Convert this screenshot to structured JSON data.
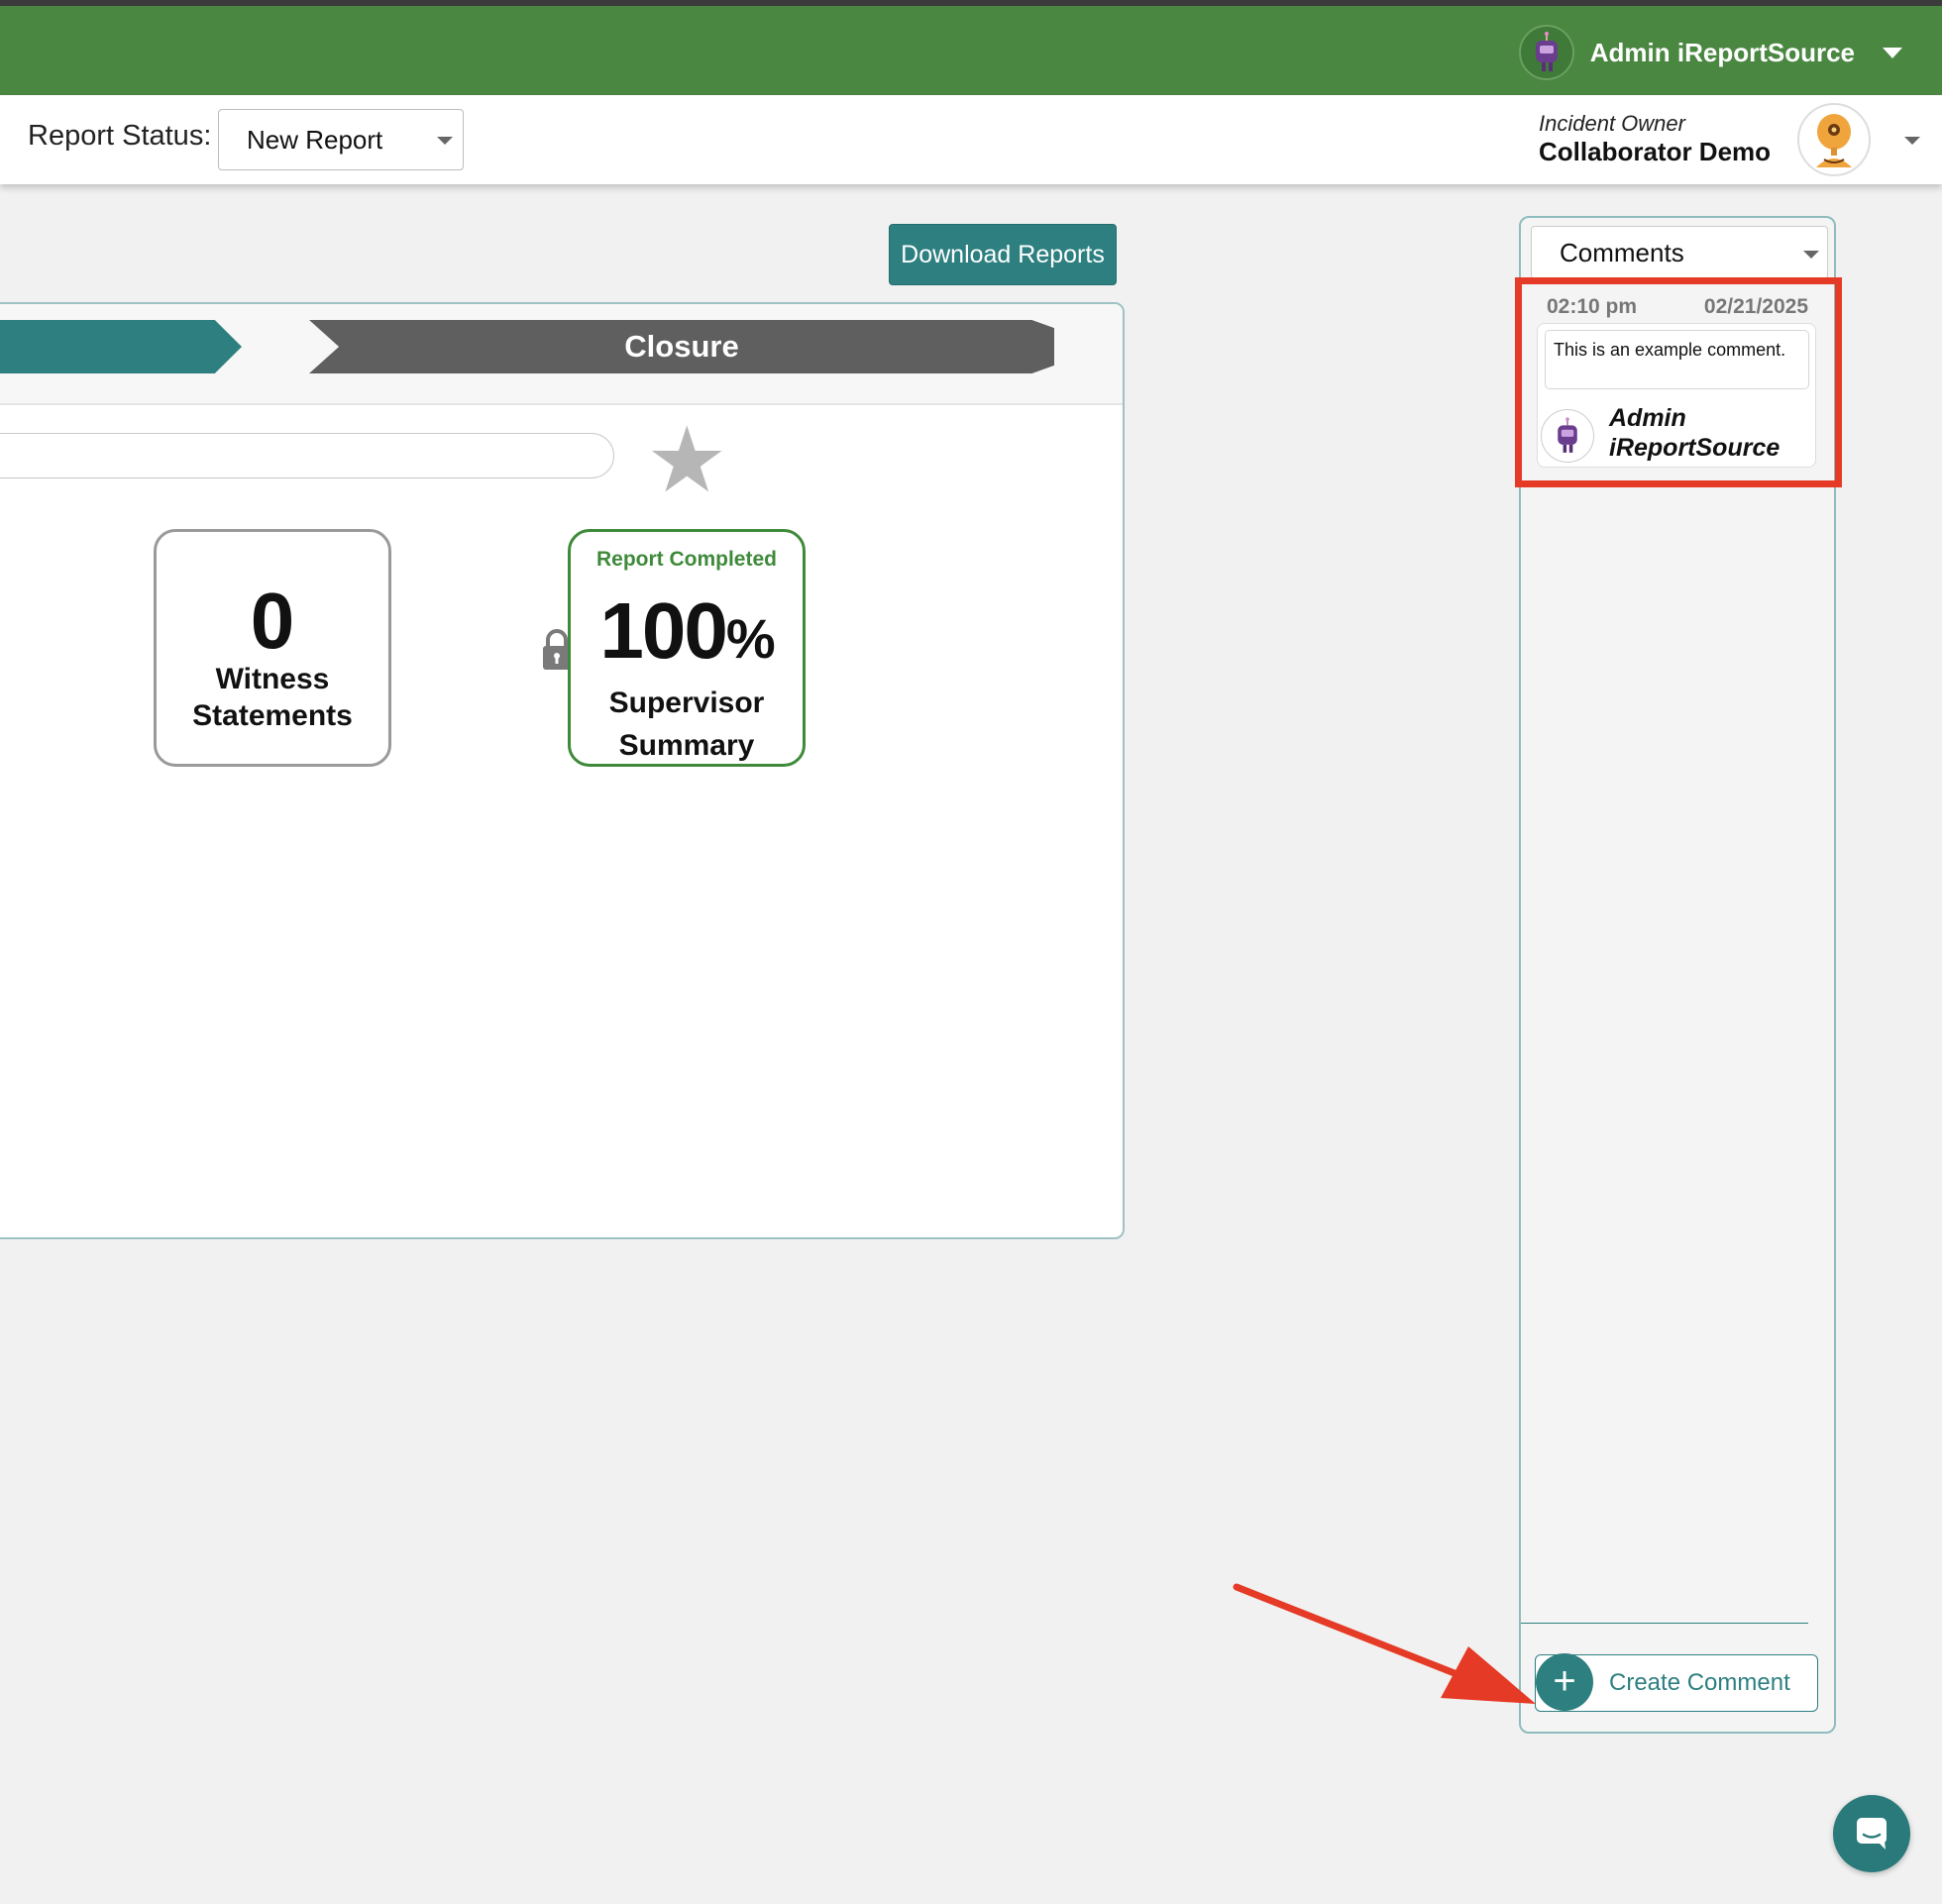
{
  "header": {
    "user_name": "Admin iReportSource",
    "user_avatar_icon": "robot-avatar-icon"
  },
  "status_bar": {
    "label": "Report Status:",
    "selected_status": "New Report",
    "owner_label": "Incident Owner",
    "owner_name": "Collaborator Demo"
  },
  "toolbar": {
    "download_label": "Download Reports"
  },
  "phases": {
    "current": "Closure"
  },
  "stats": {
    "witness": {
      "count": "0",
      "label_line1": "Witness",
      "label_line2": "Statements"
    },
    "supervisor": {
      "status": "Report Completed",
      "percent": "100",
      "percent_sign": "%",
      "label_line1": "Supervisor",
      "label_line2": "Summary"
    }
  },
  "comments": {
    "header_select": "Comments",
    "items": [
      {
        "time": "02:10 pm",
        "date": "02/21/2025",
        "text": "This is an example comment.",
        "author_line1": "Admin",
        "author_line2": "iReportSource"
      }
    ],
    "create_label": "Create Comment"
  },
  "colors": {
    "brand_green": "#4a8741",
    "teal": "#2e7f80",
    "annotation_red": "#e53a25"
  }
}
